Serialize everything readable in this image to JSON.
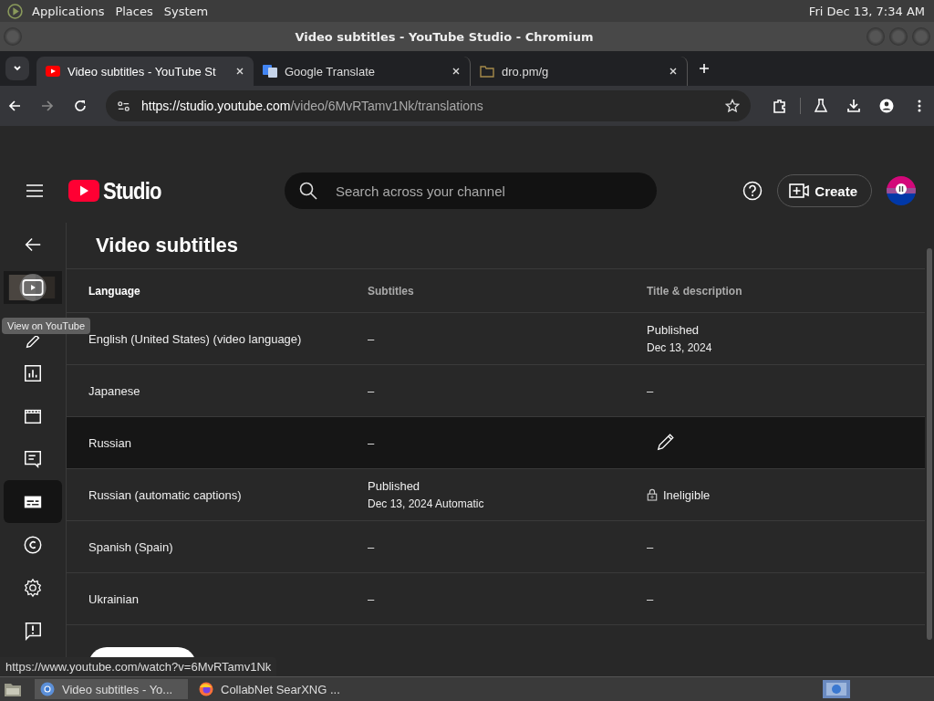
{
  "desktop_panel": {
    "menus": [
      "Applications",
      "Places",
      "System"
    ],
    "clock": "Fri Dec 13, 7:34 AM"
  },
  "window": {
    "title": "Video subtitles - YouTube Studio - Chromium"
  },
  "tabs": [
    {
      "title": "Video subtitles - YouTube St",
      "kind": "youtube",
      "selected": true
    },
    {
      "title": "Google Translate",
      "kind": "translate",
      "selected": false
    },
    {
      "title": "dro.pm/g",
      "kind": "folder",
      "selected": false
    }
  ],
  "address_bar": {
    "url_host": "https://studio.youtube.com",
    "url_path": "/video/6MvRTamv1Nk/translations"
  },
  "header": {
    "logo": "Studio",
    "search_placeholder": "Search across your channel",
    "create_label": "Create"
  },
  "sidebar": {
    "items": [
      {
        "kind": "back",
        "selected": false
      },
      {
        "kind": "thumbnail",
        "selected": false
      },
      {
        "kind": "edit",
        "selected": false
      },
      {
        "kind": "analytics",
        "selected": false
      },
      {
        "kind": "editor",
        "selected": false
      },
      {
        "kind": "comments",
        "selected": false
      },
      {
        "kind": "subtitles",
        "selected": true
      },
      {
        "kind": "copyright",
        "selected": false
      },
      {
        "kind": "settings",
        "selected": false
      },
      {
        "kind": "feedback",
        "selected": false
      }
    ],
    "tooltip": "View on YouTube"
  },
  "page_title": "Video subtitles",
  "table": {
    "columns": [
      "Language",
      "Subtitles",
      "Title & description"
    ],
    "rows": [
      {
        "language": "English (United States) (video language)",
        "hovered": false,
        "subtitles": {
          "kind": "dash",
          "text": "–"
        },
        "title_description": {
          "kind": "status",
          "text": "Published",
          "detail": "Dec 13, 2024"
        }
      },
      {
        "language": "Japanese",
        "hovered": false,
        "subtitles": {
          "kind": "dash",
          "text": "–"
        },
        "title_description": {
          "kind": "dash",
          "text": "–"
        }
      },
      {
        "language": "Russian",
        "hovered": true,
        "subtitles": {
          "kind": "dash",
          "text": "–"
        },
        "title_description": {
          "kind": "edit"
        }
      },
      {
        "language": "Russian (automatic captions)",
        "hovered": false,
        "subtitles": {
          "kind": "status",
          "text": "Published",
          "detail": "Dec 13, 2024 Automatic"
        },
        "title_description": {
          "kind": "locked",
          "text": "Ineligible"
        }
      },
      {
        "language": "Spanish (Spain)",
        "hovered": false,
        "subtitles": {
          "kind": "dash",
          "text": "–"
        },
        "title_description": {
          "kind": "dash",
          "text": "–"
        }
      },
      {
        "language": "Ukrainian",
        "hovered": false,
        "subtitles": {
          "kind": "dash",
          "text": "–"
        },
        "title_description": {
          "kind": "dash",
          "text": "–"
        }
      }
    ]
  },
  "status_url": "https://www.youtube.com/watch?v=6MvRTamv1Nk",
  "taskbar": [
    {
      "title": "Video subtitles - Yo...",
      "kind": "chromium",
      "selected": true
    },
    {
      "title": "CollabNet SearXNG ...",
      "kind": "firefox",
      "selected": false
    }
  ]
}
